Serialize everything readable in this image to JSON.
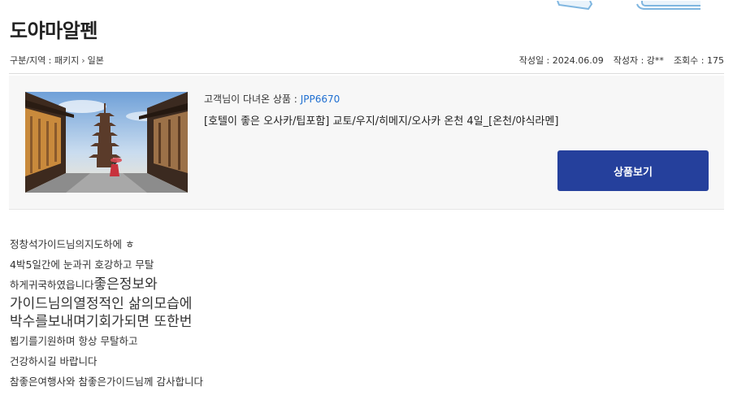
{
  "header": {
    "title": "도야마알펜"
  },
  "breadcrumb": {
    "category_label": "구분/지역 : 패키지",
    "region": "일본"
  },
  "meta": {
    "date": "작성일 : 2024.06.09",
    "author": "작성자 : 강**",
    "views": "조회수 : 175"
  },
  "product": {
    "code_prefix": "고객님이 다녀온 상품 :",
    "code": "JPP6670",
    "name": "[호텔이 좋은 오사카/팁포함] 교토/우지/히메지/오사카 온천 4일_[온천/야식라멘]",
    "button_label": "상품보기"
  },
  "review": {
    "lines": [
      "정창석가이드님의지도하에 ㅎ",
      "4박5일간에 눈과귀 호강하고 무탈",
      "하게귀국하였읍니다",
      "좋은정보와",
      "가이드님의열정적인 삶의모습에",
      "박수를보내며기회가되면 또한번",
      "뵙기를기원하며  항상 무탈하고",
      "건강하시길 바랍니다",
      "참좋은여행사와 참좋은가이드님께 감사합니다"
    ]
  },
  "colors": {
    "accent": "#25409c",
    "code_link": "#1f6fd1",
    "box_bg": "#f7f7f7"
  }
}
